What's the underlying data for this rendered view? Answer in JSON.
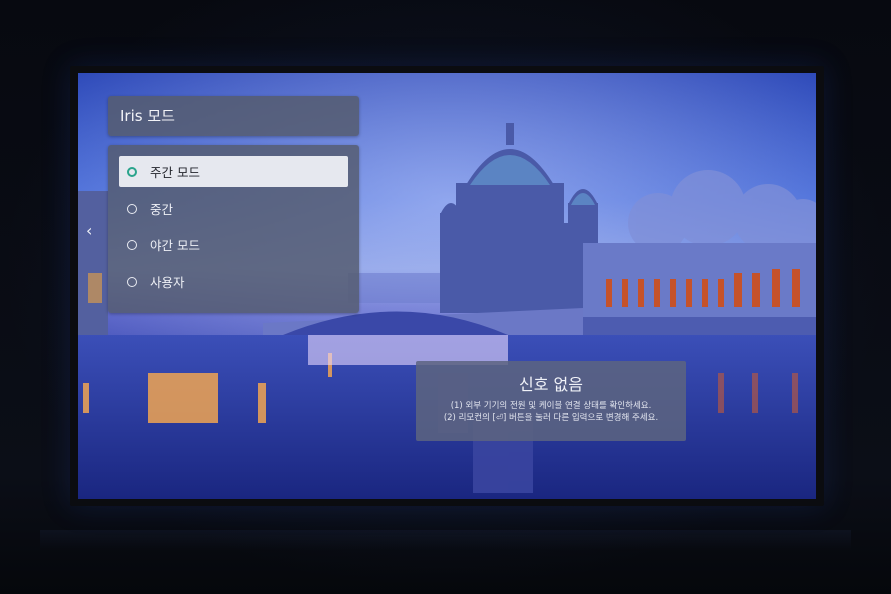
{
  "menu": {
    "title": "Iris 모드",
    "options": [
      {
        "label": "주간 모드",
        "selected": true
      },
      {
        "label": "중간",
        "selected": false
      },
      {
        "label": "야간 모드",
        "selected": false
      },
      {
        "label": "사용자",
        "selected": false
      }
    ],
    "accent_color": "#2aa48c"
  },
  "back_icon": "chevron-left-icon",
  "no_signal": {
    "title": "신호 없음",
    "line1": "(1) 외부 기기의 전원 및 케이블 연결 상태를 확인하세요.",
    "line2": "(2) 리모컨의 [⏎] 버튼을 눌러 다른 입력으로 변경해 주세요."
  }
}
